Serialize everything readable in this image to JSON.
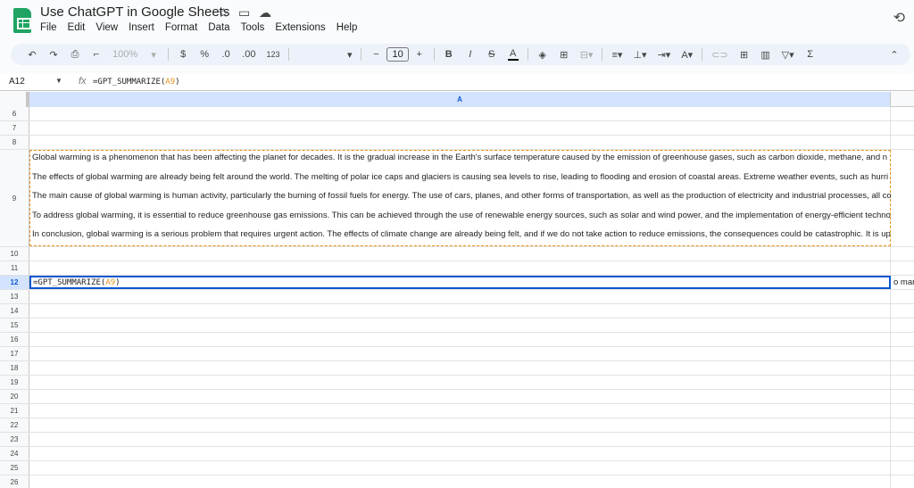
{
  "doc_title": "Use ChatGPT in Google Sheets",
  "menu": [
    "File",
    "Edit",
    "View",
    "Insert",
    "Format",
    "Data",
    "Tools",
    "Extensions",
    "Help"
  ],
  "toolbar": {
    "zoom": "100%",
    "currency": "$",
    "percent": "%",
    "dec_decrease": ".0",
    "dec_increase": ".00",
    "number_format": "123",
    "font_size": "10"
  },
  "name_box": "A12",
  "formula": {
    "prefix": "=GPT_SUMMARIZE(",
    "ref": "A9",
    "suffix": ")"
  },
  "column_header": "A",
  "rows": {
    "r6": "6",
    "r7": "7",
    "r8": "8",
    "r9": "9",
    "r10": "10",
    "r11": "11",
    "r12": "12"
  },
  "more_rows": [
    "13",
    "14",
    "15",
    "16",
    "17",
    "18",
    "19",
    "20",
    "21",
    "22",
    "23",
    "24",
    "25",
    "26"
  ],
  "a9_lines": [
    "Global warming is a phenomenon that has been affecting the planet for decades. It is the gradual increase in the Earth's surface temperature caused by the emission of greenhouse gases, such as carbon dioxide, methane, and n",
    "The effects of global warming are already being felt around the world. The melting of polar ice caps and glaciers is causing sea levels to rise, leading to flooding and erosion of coastal areas. Extreme weather events, such as hurri",
    "The main cause of global warming is human activity, particularly the burning of fossil fuels for energy. The use of cars, planes, and other forms of transportation, as well as the production of electricity and industrial processes, all co",
    "To address global warming, it is essential to reduce greenhouse gas emissions. This can be achieved through the use of renewable energy sources, such as solar and wind power, and the implementation of energy-efficient techno",
    "In conclusion, global warming is a serious problem that requires urgent action. The effects of climate change are already being felt, and if we do not take action to reduce emissions, the consequences could be catastrophic. It is up"
  ],
  "b12_overflow": "o mar",
  "colors": {
    "selection": "#0b57d0",
    "reference": "#e8911f",
    "brand": "#1fa463"
  }
}
